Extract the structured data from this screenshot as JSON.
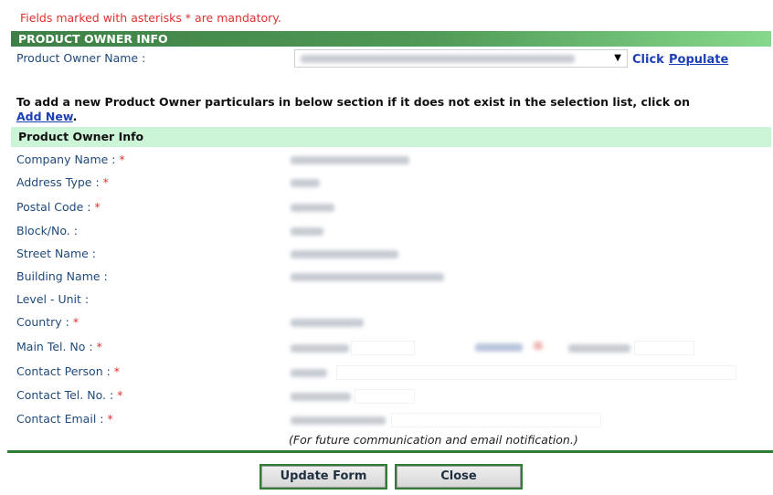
{
  "notice": "Fields marked with asterisks * are mandatory.",
  "section_title": "PRODUCT OWNER INFO",
  "owner_name_label": "Product Owner Name :",
  "owner_select_arrow": "▼",
  "click_label": "Click",
  "populate_label": "Populate",
  "add_new_text": "To add a new Product Owner particulars in below section if it does not exist in the selection list, click on",
  "add_new_link": "Add New",
  "add_new_period": ".",
  "subsection_title": "Product Owner Info",
  "fields": {
    "company_name": "Company Name :",
    "address_type": "Address Type :",
    "postal_code": "Postal Code :",
    "block_no": "Block/No. :",
    "street_name": "Street Name :",
    "building_name": "Building Name :",
    "level_unit": "Level - Unit :",
    "country": "Country :",
    "main_tel": "Main Tel. No :",
    "contact_person": "Contact Person :",
    "contact_tel": "Contact Tel. No. :",
    "contact_email": "Contact Email :"
  },
  "required_mark": "*",
  "email_note": "(For future communication and email notification.)",
  "buttons": {
    "update": "Update Form",
    "close": "Close"
  }
}
